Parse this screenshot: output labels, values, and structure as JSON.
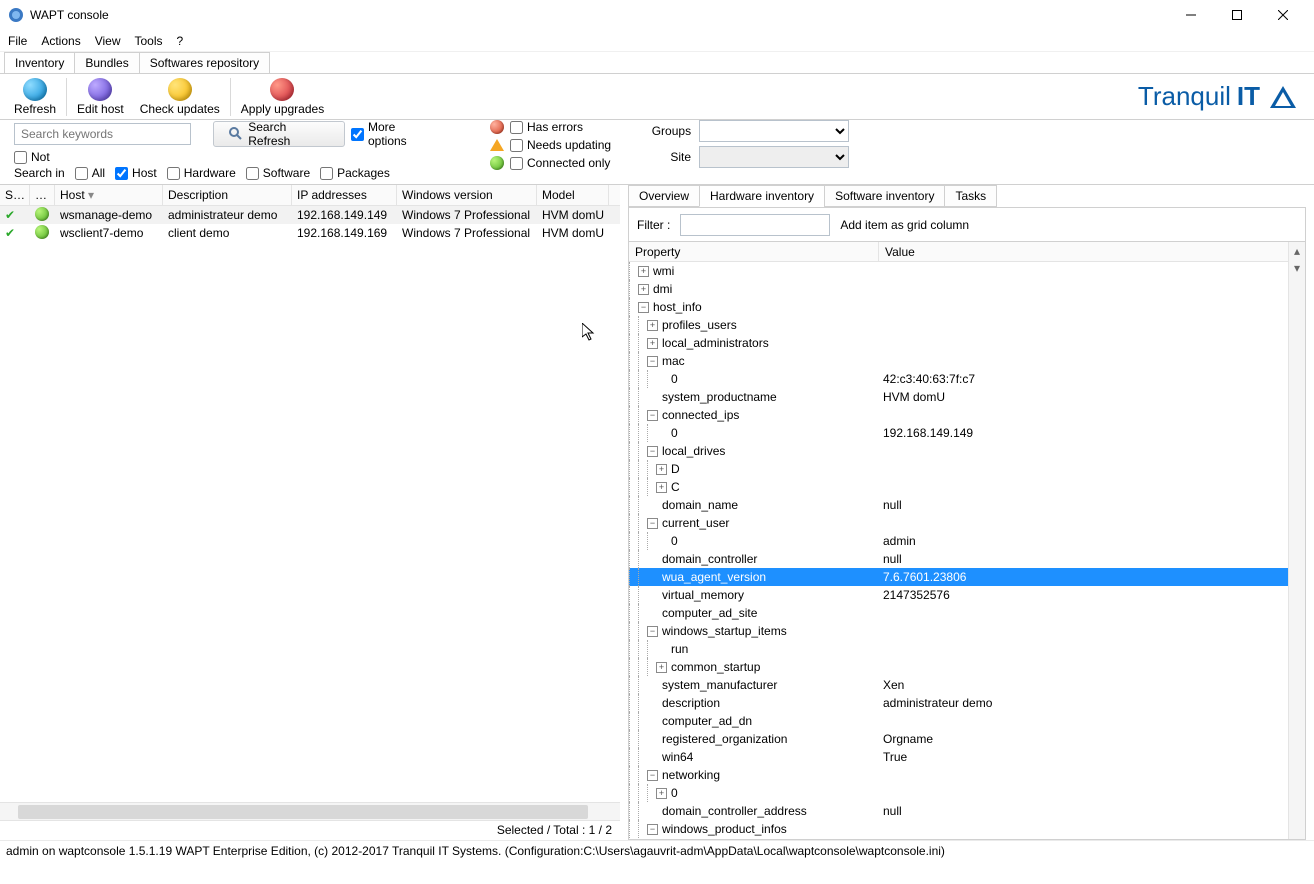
{
  "window": {
    "title": "WAPT console"
  },
  "menu": {
    "file": "File",
    "actions": "Actions",
    "view": "View",
    "tools": "Tools",
    "help": "?"
  },
  "maintabs": {
    "inventory": "Inventory",
    "bundles": "Bundles",
    "softrepo": "Softwares repository"
  },
  "toolbar": {
    "refresh": "Refresh",
    "edithost": "Edit host",
    "checkupdates": "Check updates",
    "applyupgrades": "Apply upgrades"
  },
  "logo": {
    "text": "Tranquil",
    "bold": "IT"
  },
  "search": {
    "placeholder": "Search keywords",
    "refresh_btn": "Search Refresh",
    "more_options": "More options",
    "not": "Not"
  },
  "searchin": {
    "label": "Search in",
    "all": "All",
    "host": "Host",
    "hardware": "Hardware",
    "software": "Software",
    "packages": "Packages"
  },
  "statusfilters": {
    "has_errors": "Has errors",
    "needs_updating": "Needs updating",
    "connected_only": "Connected only"
  },
  "groupsite": {
    "groups": "Groups",
    "site": "Site"
  },
  "grid": {
    "cols": {
      "s": "S…",
      "r": "…",
      "host": "Host",
      "desc": "Description",
      "ip": "IP addresses",
      "win": "Windows version",
      "model": "Model"
    },
    "rows": [
      {
        "host": "wsmanage-demo",
        "desc": "administrateur demo",
        "ip": "192.168.149.149",
        "win": "Windows 7 Professional",
        "model": "HVM domU"
      },
      {
        "host": "wsclient7-demo",
        "desc": "client demo",
        "ip": "192.168.149.169",
        "win": "Windows 7 Professional",
        "model": "HVM domU"
      }
    ],
    "status": "Selected / Total : 1 / 2"
  },
  "rtabs": {
    "overview": "Overview",
    "hwinv": "Hardware inventory",
    "swinv": "Software inventory",
    "tasks": "Tasks"
  },
  "rfilter": {
    "label": "Filter :",
    "add_btn": "Add item as grid column"
  },
  "treeh": {
    "property": "Property",
    "value": "Value"
  },
  "tree": [
    {
      "d": 1,
      "e": "+",
      "k": "wmi"
    },
    {
      "d": 1,
      "e": "+",
      "k": "dmi"
    },
    {
      "d": 1,
      "e": "-",
      "k": "host_info"
    },
    {
      "d": 2,
      "e": "+",
      "k": "profiles_users"
    },
    {
      "d": 2,
      "e": "+",
      "k": "local_administrators"
    },
    {
      "d": 2,
      "e": "-",
      "k": "mac"
    },
    {
      "d": 3,
      "e": "",
      "k": "0",
      "v": "42:c3:40:63:7f:c7"
    },
    {
      "d": 2,
      "e": "",
      "k": "system_productname",
      "v": "HVM domU"
    },
    {
      "d": 2,
      "e": "-",
      "k": "connected_ips"
    },
    {
      "d": 3,
      "e": "",
      "k": "0",
      "v": "192.168.149.149"
    },
    {
      "d": 2,
      "e": "-",
      "k": "local_drives"
    },
    {
      "d": 3,
      "e": "+",
      "k": "D"
    },
    {
      "d": 3,
      "e": "+",
      "k": "C"
    },
    {
      "d": 2,
      "e": "",
      "k": "domain_name",
      "v": "null"
    },
    {
      "d": 2,
      "e": "-",
      "k": "current_user"
    },
    {
      "d": 3,
      "e": "",
      "k": "0",
      "v": "admin"
    },
    {
      "d": 2,
      "e": "",
      "k": "domain_controller",
      "v": "null"
    },
    {
      "d": 2,
      "e": "",
      "k": "wua_agent_version",
      "v": "7.6.7601.23806",
      "sel": true
    },
    {
      "d": 2,
      "e": "",
      "k": "virtual_memory",
      "v": "2147352576"
    },
    {
      "d": 2,
      "e": "",
      "k": "computer_ad_site"
    },
    {
      "d": 2,
      "e": "-",
      "k": "windows_startup_items"
    },
    {
      "d": 3,
      "e": "",
      "k": "run"
    },
    {
      "d": 3,
      "e": "+",
      "k": "common_startup"
    },
    {
      "d": 2,
      "e": "",
      "k": "system_manufacturer",
      "v": "Xen"
    },
    {
      "d": 2,
      "e": "",
      "k": "description",
      "v": "administrateur demo"
    },
    {
      "d": 2,
      "e": "",
      "k": "computer_ad_dn"
    },
    {
      "d": 2,
      "e": "",
      "k": "registered_organization",
      "v": "Orgname"
    },
    {
      "d": 2,
      "e": "",
      "k": "win64",
      "v": "True"
    },
    {
      "d": 2,
      "e": "-",
      "k": "networking"
    },
    {
      "d": 3,
      "e": "+",
      "k": "0"
    },
    {
      "d": 2,
      "e": "",
      "k": "domain_controller_address",
      "v": "null"
    },
    {
      "d": 2,
      "e": "-",
      "k": "windows_product_infos"
    }
  ],
  "statusbar": "admin on waptconsole 1.5.1.19 WAPT Enterprise Edition, (c) 2012-2017 Tranquil IT Systems. (Configuration:C:\\Users\\agauvrit-adm\\AppData\\Local\\waptconsole\\waptconsole.ini)"
}
